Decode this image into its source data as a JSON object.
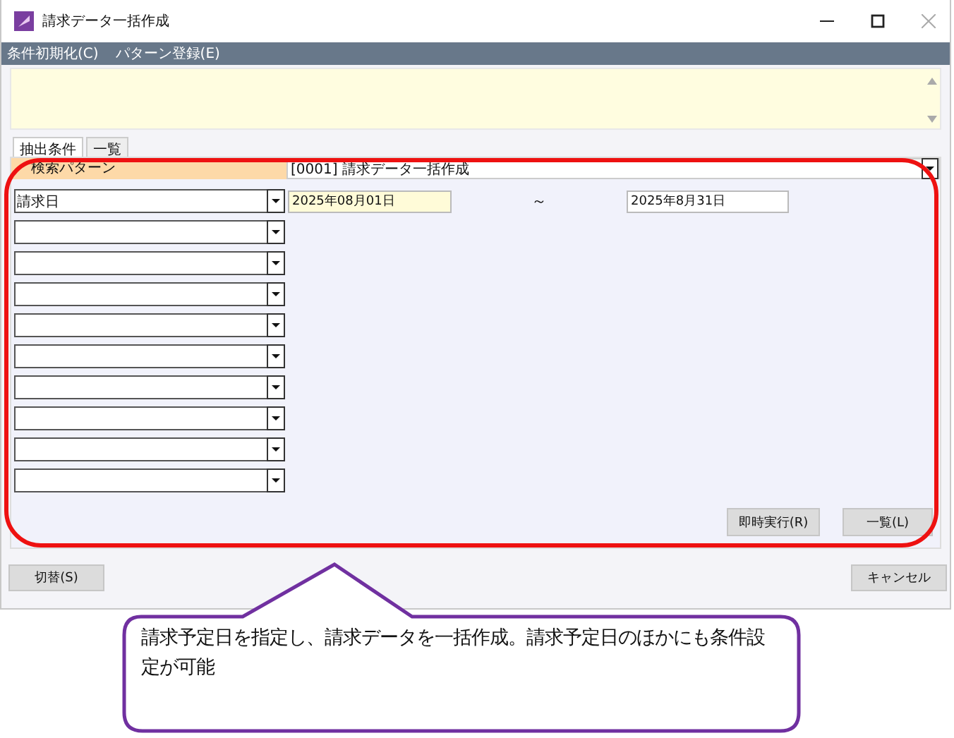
{
  "window": {
    "title": "請求データ一括作成"
  },
  "menu": [
    "条件初期化(C)",
    "パターン登録(E)"
  ],
  "tabs": [
    {
      "label": "抽出条件",
      "selected": true
    },
    {
      "label": "一覧",
      "selected": false
    }
  ],
  "pattern": {
    "label": "検索パターン",
    "value": "[0001] 請求データ一括作成"
  },
  "conditions": [
    {
      "kind": "date_range",
      "field": "請求日",
      "from": "2025年08月01日",
      "separator": "～",
      "to": "2025年8月31日"
    },
    {
      "kind": "empty"
    },
    {
      "kind": "empty"
    },
    {
      "kind": "empty"
    },
    {
      "kind": "empty"
    },
    {
      "kind": "empty"
    },
    {
      "kind": "empty"
    },
    {
      "kind": "empty"
    },
    {
      "kind": "empty"
    },
    {
      "kind": "empty"
    }
  ],
  "actions": [
    "即時実行(R)",
    "一覧(L)"
  ],
  "footer": {
    "left": "切替(S)",
    "right": "キャンセル"
  },
  "callout": {
    "text": "請求予定日を指定し、請求データを一括作成。請求予定日のほかにも条件設定が可能"
  }
}
